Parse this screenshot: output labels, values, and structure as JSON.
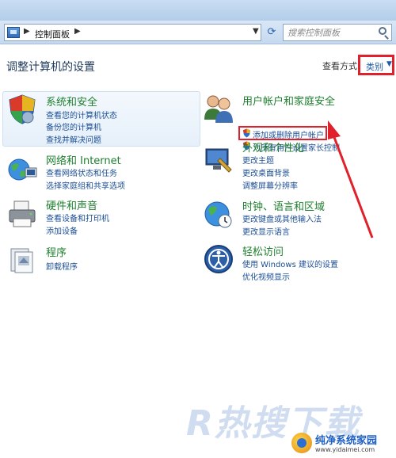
{
  "address_bar": {
    "location": "控制面板",
    "search_placeholder": "搜索控制面板"
  },
  "page_title": "调整计算机的设置",
  "view_by": {
    "label": "查看方式",
    "value": "类别"
  },
  "categories": [
    {
      "title": "系统和安全",
      "icon": "shield-icon",
      "links": [
        "查看您的计算机状态",
        "备份您的计算机",
        "查找并解决问题"
      ]
    },
    {
      "title": "网络和 Internet",
      "icon": "network-globe-icon",
      "links": [
        "查看网络状态和任务",
        "选择家庭组和共享选项"
      ]
    },
    {
      "title": "硬件和声音",
      "icon": "printer-icon",
      "links": [
        "查看设备和打印机",
        "添加设备"
      ]
    },
    {
      "title": "程序",
      "icon": "programs-icon",
      "links": [
        "卸载程序"
      ]
    },
    {
      "title": "用户帐户和家庭安全",
      "icon": "users-icon",
      "links": [
        "添加或删除用户帐户",
        "为所有用户设置家长控制"
      ]
    },
    {
      "title": "外观和个性化",
      "icon": "display-icon",
      "links": [
        "更改主题",
        "更改桌面背景",
        "调整屏幕分辨率"
      ]
    },
    {
      "title": "时钟、语言和区域",
      "icon": "clock-globe-icon",
      "links": [
        "更改键盘或其他输入法",
        "更改显示语言"
      ]
    },
    {
      "title": "轻松访问",
      "icon": "ease-of-access-icon",
      "links": [
        "使用 Windows 建议的设置",
        "优化视频显示"
      ]
    }
  ],
  "watermark_text": "R热搜下载",
  "logo": {
    "name": "纯净系统家园",
    "url": "www.yidaimei.com"
  },
  "colors": {
    "category_title": "#1e7f2e",
    "link": "#1c4f94",
    "annotation_red": "#e0202a"
  }
}
